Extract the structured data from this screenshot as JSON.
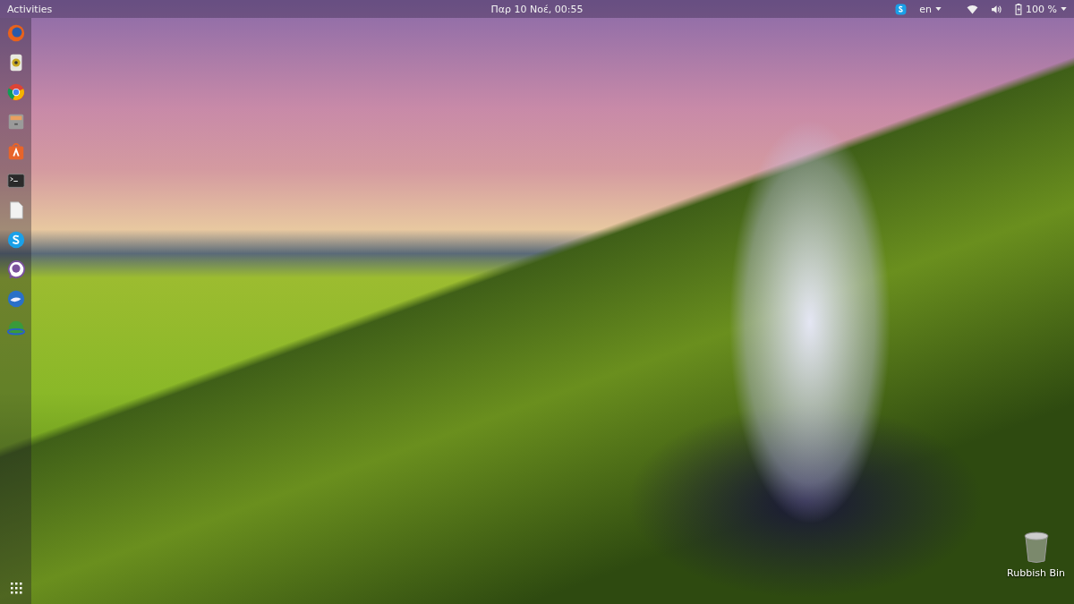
{
  "top_bar": {
    "activities": "Activities",
    "clock": "Παρ 10 Νοέ, 00:55",
    "language": "en",
    "battery": "100 %"
  },
  "desktop_icons": [
    {
      "label": "Rubbish Bin"
    }
  ]
}
